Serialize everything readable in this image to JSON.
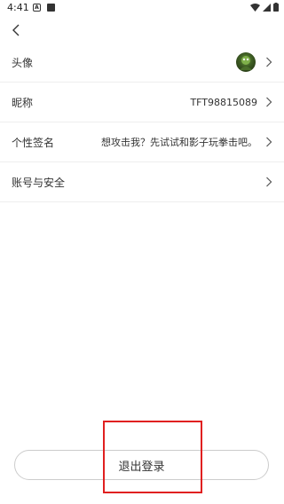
{
  "status_bar": {
    "time": "4:41",
    "notif_a": "A"
  },
  "settings": {
    "items": [
      {
        "label": "头像",
        "value": ""
      },
      {
        "label": "昵称",
        "value": "TFT98815089"
      },
      {
        "label": "个性签名",
        "value": "想攻击我？先试试和影子玩拳击吧。"
      },
      {
        "label": "账号与安全",
        "value": ""
      }
    ]
  },
  "logout": {
    "label": "退出登录"
  },
  "colors": {
    "highlight": "#e02020",
    "divider": "#eeeeee"
  }
}
